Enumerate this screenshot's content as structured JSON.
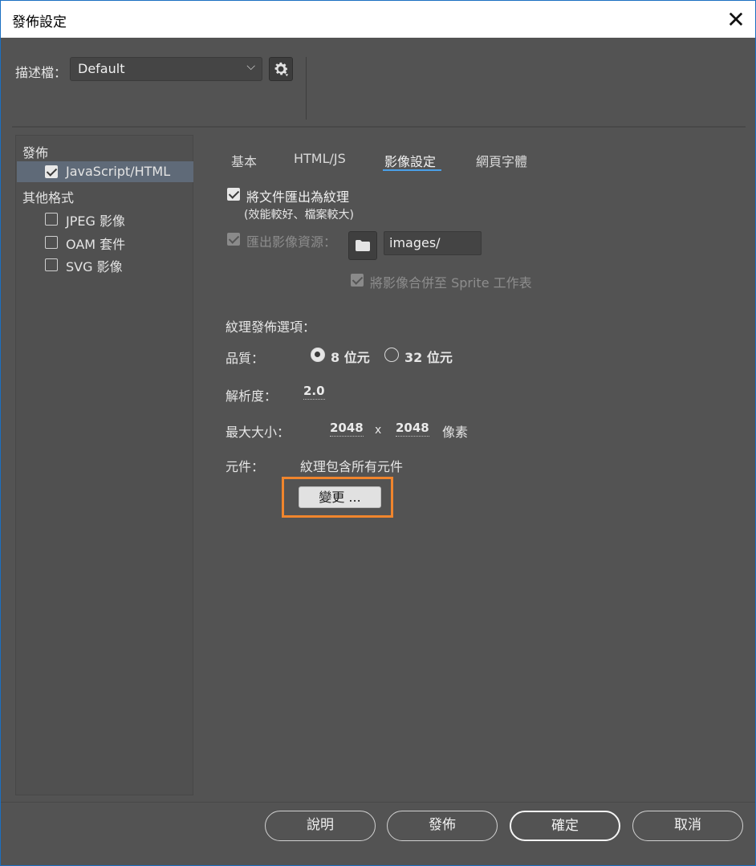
{
  "window": {
    "title": "發佈設定",
    "close_glyph": "✕"
  },
  "profile": {
    "label": "描述檔：",
    "value": "Default",
    "chevron": "⌵",
    "settings_icon": "gear-icon"
  },
  "sidebar": {
    "publish_heading": "發佈",
    "publish_items": [
      {
        "label": "JavaScript/HTML",
        "checked": true,
        "selected": true
      }
    ],
    "other_heading": "其他格式",
    "other_items": [
      {
        "label": "JPEG 影像",
        "checked": false
      },
      {
        "label": "OAM 套件",
        "checked": false
      },
      {
        "label": "SVG 影像",
        "checked": false
      }
    ]
  },
  "tabs": [
    {
      "label": "基本",
      "active": false
    },
    {
      "label": "HTML/JS",
      "active": false
    },
    {
      "label": "影像設定",
      "active": true
    },
    {
      "label": "網頁字體",
      "active": false
    }
  ],
  "image_settings": {
    "export_doc_texture": {
      "label": "將文件匯出為紋理",
      "hint": "(效能較好、檔案較大)",
      "checked": true
    },
    "export_image_assets": {
      "label": "匯出影像資源：",
      "checked": true,
      "disabled": true,
      "folder_icon": "folder-icon",
      "path": "images/"
    },
    "combine_sprite": {
      "label": "將影像合併至 Sprite 工作表",
      "checked": true,
      "disabled": true
    },
    "texture_options_heading": "紋理發佈選項：",
    "quality": {
      "label": "品質：",
      "options": [
        {
          "label": "8 位元",
          "selected": true
        },
        {
          "label": "32 位元",
          "selected": false
        }
      ]
    },
    "resolution": {
      "label": "解析度：",
      "value": "2.0"
    },
    "max_size": {
      "label": "最大大小：",
      "width": "2048",
      "separator": "x",
      "height": "2048",
      "unit": "像素"
    },
    "symbols": {
      "label": "元件：",
      "value": "紋理包含所有元件",
      "change_button": "變更 ...",
      "highlight_color": "#f0852d"
    }
  },
  "footer": {
    "help": "說明",
    "publish": "發佈",
    "ok": "確定",
    "cancel": "取消"
  },
  "colors": {
    "background": "#535353",
    "accent_underline": "#4aa0e8",
    "selection": "#5f6a78"
  }
}
